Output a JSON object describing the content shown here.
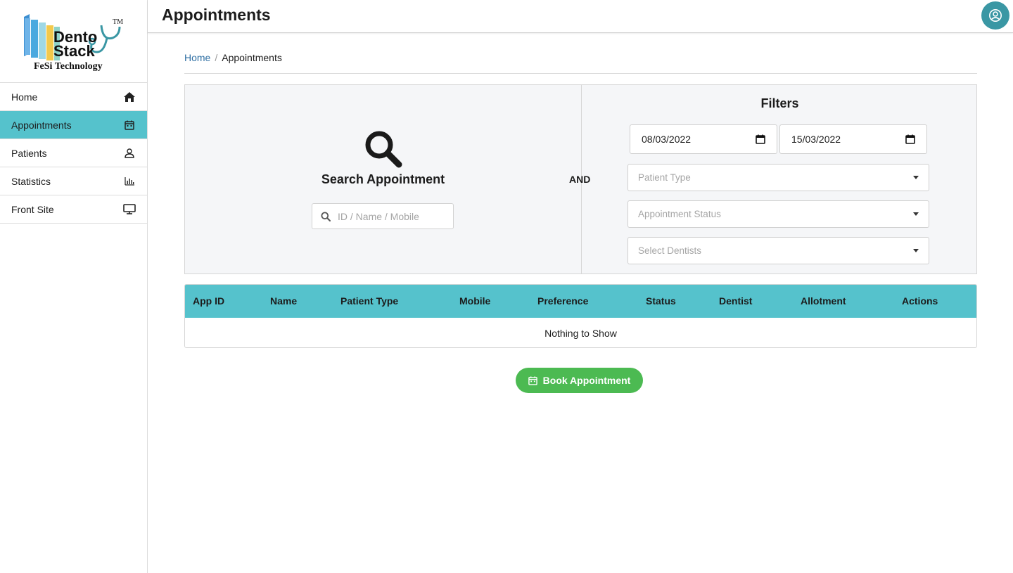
{
  "brand": {
    "name_line1": "Dento",
    "name_line2": "Stack",
    "trademark": "TM",
    "tagline": "FeSi Technology",
    "accent": "#55c2cc"
  },
  "sidebar": {
    "items": [
      {
        "label": "Home",
        "icon": "home-icon",
        "active": false
      },
      {
        "label": "Appointments",
        "icon": "calendar-icon",
        "active": true
      },
      {
        "label": "Patients",
        "icon": "user-icon",
        "active": false
      },
      {
        "label": "Statistics",
        "icon": "bar-chart-icon",
        "active": false
      },
      {
        "label": "Front Site",
        "icon": "monitor-icon",
        "active": false
      }
    ]
  },
  "header": {
    "title": "Appointments",
    "avatar_icon": "user-circle-icon"
  },
  "breadcrumb": {
    "home": "Home",
    "separator": "/",
    "current": "Appointments"
  },
  "search": {
    "title": "Search Appointment",
    "placeholder": "ID / Name / Mobile",
    "icon": "search-icon"
  },
  "and_label": "AND",
  "filters": {
    "title": "Filters",
    "date_from": "08/03/2022",
    "date_to": "15/03/2022",
    "patient_type_placeholder": "Patient Type",
    "status_placeholder": "Appointment Status",
    "dentist_placeholder": "Select Dentists"
  },
  "table": {
    "columns": [
      "App ID",
      "Name",
      "Patient Type",
      "Mobile",
      "Preference",
      "Status",
      "Dentist",
      "Allotment",
      "Actions"
    ],
    "empty_text": "Nothing to Show"
  },
  "book_button": {
    "label": "Book Appointment",
    "color": "#4cba52"
  }
}
